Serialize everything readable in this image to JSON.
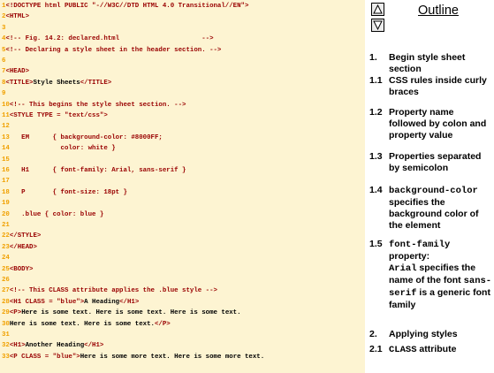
{
  "code": {
    "lines": [
      {
        "n": "1",
        "parts": [
          {
            "k": "tag",
            "t": "<!DOCTYPE html PUBLIC \"-//W3C//DTD HTML 4.0 Transitional//EN\">"
          }
        ]
      },
      {
        "n": "2",
        "parts": [
          {
            "k": "tag",
            "t": "<HTML>"
          }
        ]
      },
      {
        "n": "3",
        "parts": []
      },
      {
        "n": "4",
        "parts": [
          {
            "k": "cmt",
            "t": "<!-- Fig. 14.2: declared.html                     -->"
          }
        ]
      },
      {
        "n": "5",
        "parts": [
          {
            "k": "cmt",
            "t": "<!-- Declaring a style sheet in the header section. -->"
          }
        ]
      },
      {
        "n": "6",
        "parts": []
      },
      {
        "n": "7",
        "parts": [
          {
            "k": "tag",
            "t": "<HEAD>"
          }
        ]
      },
      {
        "n": "8",
        "parts": [
          {
            "k": "tag",
            "t": "<TITLE>"
          },
          {
            "k": "txt",
            "t": "Style Sheets"
          },
          {
            "k": "tag",
            "t": "</TITLE>"
          }
        ]
      },
      {
        "n": "9",
        "parts": []
      },
      {
        "n": "10",
        "parts": [
          {
            "k": "cmt",
            "t": "<!-- This begins the style sheet section. -->"
          }
        ]
      },
      {
        "n": "11",
        "parts": [
          {
            "k": "tag",
            "t": "<STYLE TYPE = \"text/css\">"
          }
        ]
      },
      {
        "n": "12",
        "parts": []
      },
      {
        "n": "13",
        "parts": [
          {
            "k": "tag",
            "t": "   EM      { background-color: #8000FF;"
          }
        ]
      },
      {
        "n": "14",
        "parts": [
          {
            "k": "tag",
            "t": "             color: white }"
          }
        ]
      },
      {
        "n": "15",
        "parts": []
      },
      {
        "n": "16",
        "parts": [
          {
            "k": "tag",
            "t": "   H1      { font-family: Arial, sans-serif }"
          }
        ]
      },
      {
        "n": "17",
        "parts": []
      },
      {
        "n": "18",
        "parts": [
          {
            "k": "tag",
            "t": "   P       { font-size: 18pt }"
          }
        ]
      },
      {
        "n": "19",
        "parts": []
      },
      {
        "n": "20",
        "parts": [
          {
            "k": "tag",
            "t": "   .blue { color: blue }"
          }
        ]
      },
      {
        "n": "21",
        "parts": []
      },
      {
        "n": "22",
        "parts": [
          {
            "k": "tag",
            "t": "</STYLE>"
          }
        ]
      },
      {
        "n": "23",
        "parts": [
          {
            "k": "tag",
            "t": "</HEAD>"
          }
        ]
      },
      {
        "n": "24",
        "parts": []
      },
      {
        "n": "25",
        "parts": [
          {
            "k": "tag",
            "t": "<BODY>"
          }
        ]
      },
      {
        "n": "26",
        "parts": []
      },
      {
        "n": "27",
        "parts": [
          {
            "k": "cmt",
            "t": "<!-- This CLASS attribute applies the .blue style -->"
          }
        ]
      },
      {
        "n": "28",
        "parts": [
          {
            "k": "tag",
            "t": "<H1 CLASS = \"blue\">"
          },
          {
            "k": "txt",
            "t": "A Heading"
          },
          {
            "k": "tag",
            "t": "</H1>"
          }
        ]
      },
      {
        "n": "29",
        "parts": [
          {
            "k": "tag",
            "t": "<P>"
          },
          {
            "k": "txt",
            "t": "Here is some text. Here is some text. Here is some text."
          }
        ]
      },
      {
        "n": "30",
        "parts": [
          {
            "k": "txt",
            "t": "Here is some text. Here is some text."
          },
          {
            "k": "tag",
            "t": "</P>"
          }
        ]
      },
      {
        "n": "31",
        "parts": []
      },
      {
        "n": "32",
        "parts": [
          {
            "k": "tag",
            "t": "<H1>"
          },
          {
            "k": "txt",
            "t": "Another Heading"
          },
          {
            "k": "tag",
            "t": "</H1>"
          }
        ]
      },
      {
        "n": "33",
        "parts": [
          {
            "k": "tag",
            "t": "<P CLASS = \"blue\">"
          },
          {
            "k": "txt",
            "t": "Here is some more text. Here is some more text."
          }
        ]
      }
    ]
  },
  "outline": {
    "title": "Outline",
    "up_icon": "triangle-up-icon",
    "down_icon": "triangle-down-icon",
    "items": [
      {
        "num": "1.",
        "text": "Begin style sheet section"
      },
      {
        "num": "1.1",
        "text": "CSS rules inside curly braces"
      },
      {
        "num": "1.2",
        "text": "Property name followed by colon and property value"
      },
      {
        "num": "1.3",
        "text": "Properties separated by semicolon"
      },
      {
        "num": "1.4",
        "code": "background-color",
        "text": " specifies the background color of the element"
      },
      {
        "num": "1.5",
        "code": "font-family",
        "text": " property:",
        "code2": "Arial",
        "text2": " specifies the name of the font ",
        "code3": "sans-serif",
        "text3": " is a generic font family"
      },
      {
        "num": "2.",
        "text": "Applying styles"
      },
      {
        "num": "2.1",
        "code": "CLASS",
        "text": " attribute"
      }
    ]
  },
  "colors": {
    "code_bg": "#fdf4d2",
    "line_number": "#f0a000",
    "tag": "#990000",
    "text": "#000000"
  }
}
